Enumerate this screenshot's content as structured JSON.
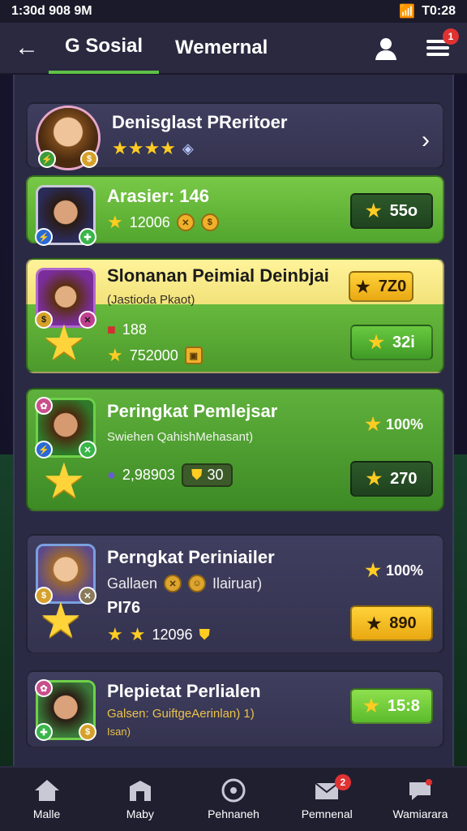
{
  "status": {
    "time": "1:30d 908 9M",
    "right_time": "T0:28"
  },
  "header": {
    "back": "←",
    "tabs": [
      "G Sosial",
      "Wemernal"
    ],
    "menu_badge": "1"
  },
  "cards": [
    {
      "title": "Denisglast PReritoer",
      "stars": "★★★★",
      "arrow": "›"
    },
    {
      "title": "Arasier: 146",
      "value": "12006",
      "button": "55o"
    },
    {
      "title": "Slonanan Peimial Deinbjai",
      "sub": "(Jastioda Pkaot)",
      "line1": "188",
      "line2": "752000",
      "badge_value": "7Z0",
      "button": "32i"
    },
    {
      "title": "Peringkat Pemlejsar",
      "sub": "Swiehen QahishMehasant)",
      "line": "2,98903",
      "chip": "30",
      "pct": "100%",
      "button": "270"
    },
    {
      "title": "Perngkat Periniailer",
      "sub_left": "Gallaen",
      "sub_right": "Ilairuar)",
      "line1": "PI76",
      "line2": "12096",
      "pct": "100%",
      "button": "890"
    },
    {
      "title": "Plepietat Perlialen",
      "sub": "Galsen: GuiftgeAerinlan) 1)",
      "sub2": "Isan)",
      "button": "15:8"
    }
  ],
  "nav": [
    {
      "label": "Malle"
    },
    {
      "label": "Maby"
    },
    {
      "label": "Pehnaneh"
    },
    {
      "label": "Pemnenal",
      "badge": "2"
    },
    {
      "label": "Wamiarara"
    }
  ],
  "colors": {
    "accent": "#5fc146",
    "gold": "#ffcc22"
  }
}
